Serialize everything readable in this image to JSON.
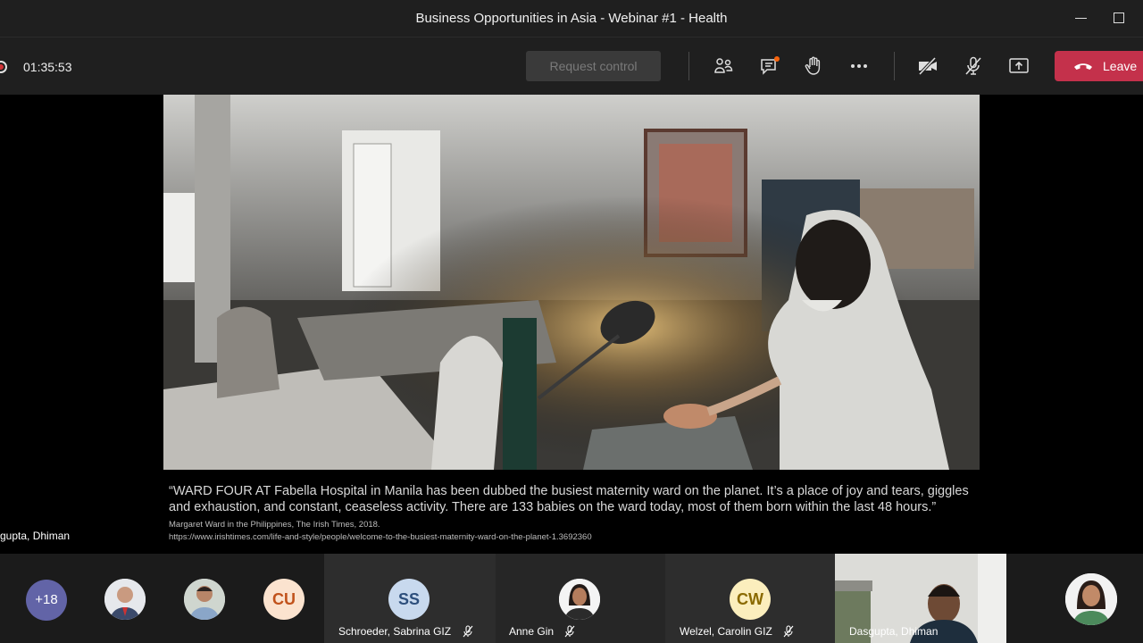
{
  "window": {
    "title": "Business Opportunities in Asia - Webinar #1 - Health"
  },
  "toolbar": {
    "timer": "01:35:53",
    "request_control_label": "Request control",
    "leave_label": "Leave",
    "icons": [
      "participants-icon",
      "chat-icon",
      "raise-hand-icon",
      "more-options-icon",
      "camera-off-icon",
      "mic-off-icon",
      "share-screen-icon",
      "phone-hangup-icon"
    ]
  },
  "slide": {
    "caption_main": "“WARD FOUR AT Fabella Hospital in Manila has been dubbed the busiest maternity ward on the planet. It’s a place of joy and tears, giggles and exhaustion, and constant, ceaseless activity. There are 133 babies on the ward today, most of them born within the last 48 hours.”",
    "caption_source": "Margaret Ward in the Philippines, The Irish Times, 2018.",
    "url": "https://www.irishtimes.com/life-and-style/people/welcome-to-the-busiest-maternity-ward-on-the-planet-1.3692360"
  },
  "presenter": {
    "name": "gupta, Dhiman"
  },
  "participants": {
    "overflow_count": "+18",
    "tiles": [
      {
        "initials": "CU",
        "name": ""
      },
      {
        "initials": "SS",
        "name": "Schroeder, Sabrina GIZ",
        "muted": true
      },
      {
        "initials": "",
        "name": "Anne Gin",
        "muted": true
      },
      {
        "initials": "CW",
        "name": "Welzel, Carolin GIZ",
        "muted": true
      },
      {
        "initials": "",
        "name": "Dasgupta, Dhiman"
      }
    ]
  },
  "colors": {
    "leave": "#c4314b",
    "overflow": "#6264a7",
    "cu_bg": "#fbe3cf",
    "ss_bg": "#c8d9ee",
    "cw_bg": "#fbeebd"
  }
}
